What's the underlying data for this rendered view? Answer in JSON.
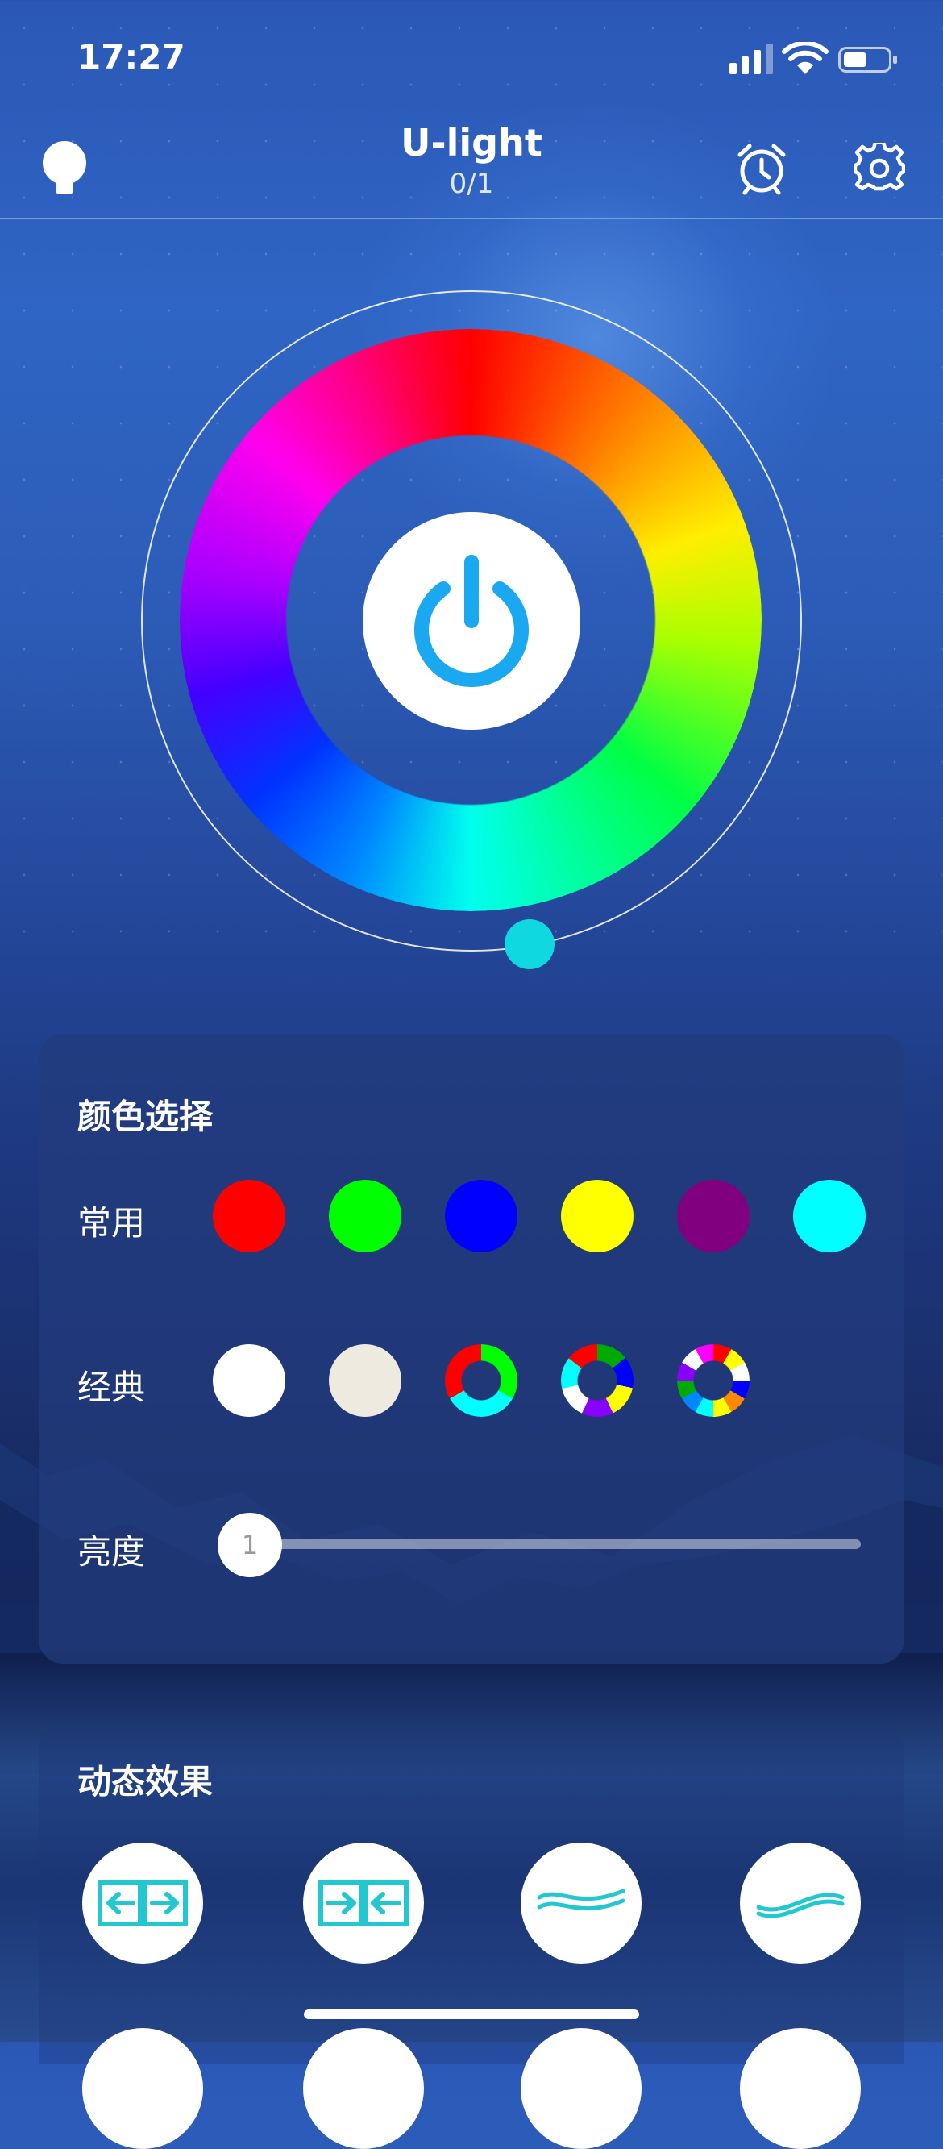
{
  "status_bar": {
    "time": "17:27"
  },
  "nav": {
    "title": "U-light",
    "subtitle": "0/1",
    "left_icon": "bulb-icon",
    "alarm_icon": "alarm-clock-icon",
    "settings_icon": "gear-icon"
  },
  "wheel": {
    "center_icon": "power-icon",
    "power_color": "#1aa8f0",
    "knob_color": "#10d8e0"
  },
  "color_panel": {
    "title": "颜色选择",
    "common_label": "常用",
    "common_colors": [
      "#ff0000",
      "#00ff00",
      "#0000ff",
      "#ffff00",
      "#800080",
      "#00ffff"
    ],
    "classic_label": "经典",
    "classic_solid_colors": [
      "#ffffff",
      "#eeeadf"
    ],
    "classic_ring_colors": [
      [
        "#ff0000",
        "#00ff00",
        "#00ffff"
      ],
      [
        "#ff0000",
        "#00aa00",
        "#0000ff",
        "#ffff00",
        "#8800ff",
        "#ffffff",
        "#00ffff"
      ],
      [
        "#ff0000",
        "#ffffff",
        "#ffff00",
        "#0000ff",
        "#ff8800",
        "#00ffff",
        "#00aa00",
        "#ff00ff",
        "#ffffff",
        "#8800ff",
        "#0088ff",
        "#ff0000"
      ]
    ],
    "brightness_label": "亮度",
    "brightness_value": "1"
  },
  "effects_panel": {
    "title": "动态效果",
    "items": [
      {
        "icon": "arrows-out-icon"
      },
      {
        "icon": "arrows-in-icon"
      },
      {
        "icon": "wave-icon"
      },
      {
        "icon": "wave-icon"
      }
    ],
    "accent": "#22c7cf"
  }
}
